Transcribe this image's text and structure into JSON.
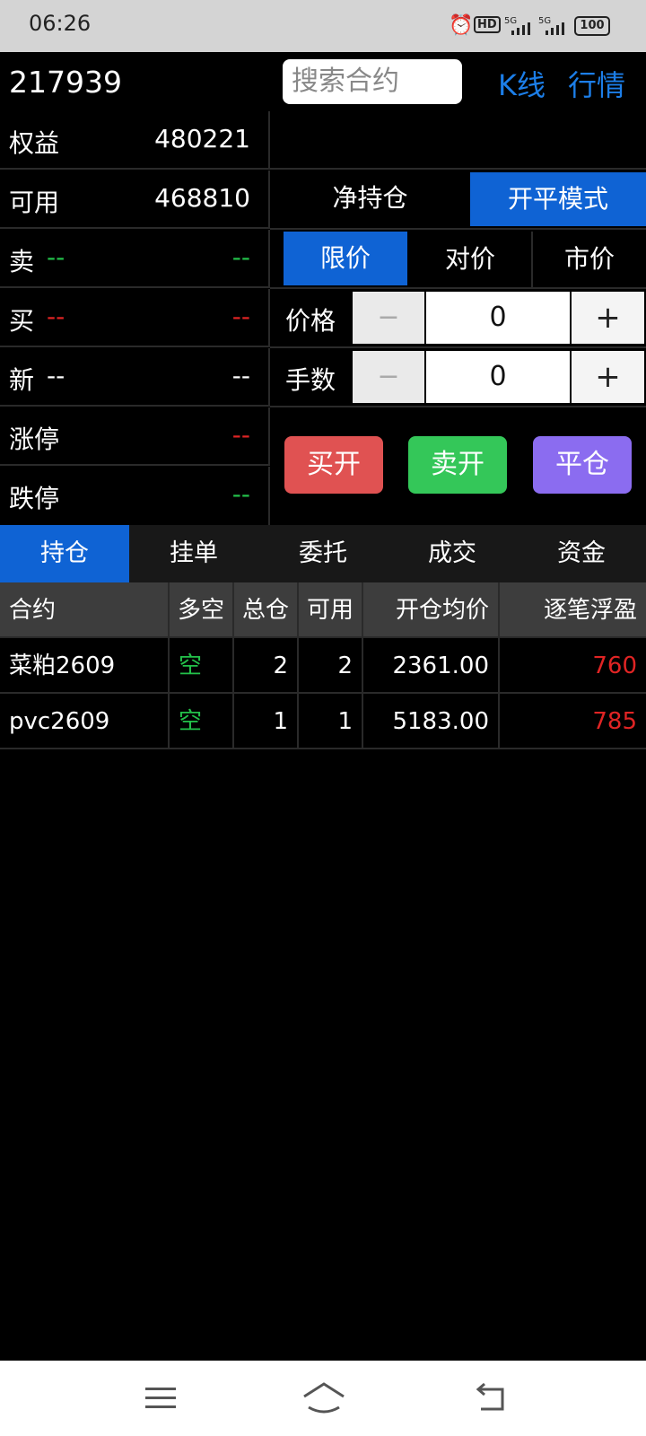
{
  "status": {
    "time": "06:26",
    "battery": "100"
  },
  "header": {
    "account_id": "217939",
    "search_placeholder": "搜索合约",
    "kline_link": "K线",
    "quotes_link": "行情"
  },
  "account": {
    "equity_label": "权益",
    "equity_value": "480221",
    "available_label": "可用",
    "available_value": "468810"
  },
  "quote": {
    "sell_label": "卖",
    "sell_price": "--",
    "sell_volume": "--",
    "buy_label": "买",
    "buy_price": "--",
    "buy_volume": "--",
    "last_label": "新",
    "last_price": "--",
    "last_change": "--",
    "limit_up_label": "涨停",
    "limit_up_value": "--",
    "limit_down_label": "跌停",
    "limit_down_value": "--"
  },
  "mode": {
    "net_position": "净持仓",
    "open_close": "开平模式",
    "active": "open_close"
  },
  "price_types": [
    "限价",
    "对价",
    "市价"
  ],
  "order": {
    "price_label": "价格",
    "price_value": "0",
    "qty_label": "手数",
    "qty_value": "0",
    "minus": "−",
    "plus": "+",
    "buy_open": "买开",
    "sell_open": "卖开",
    "close": "平仓"
  },
  "tabs": [
    "持仓",
    "挂单",
    "委托",
    "成交",
    "资金"
  ],
  "positions": {
    "columns": [
      "合约",
      "多空",
      "总仓",
      "可用",
      "开仓均价",
      "逐笔浮盈"
    ],
    "rows": [
      {
        "contract": "菜粕2609",
        "direction": "空",
        "total": "2",
        "available": "2",
        "avg_price": "2361.00",
        "pnl": "760"
      },
      {
        "contract": "pvc2609",
        "direction": "空",
        "total": "1",
        "available": "1",
        "avg_price": "5183.00",
        "pnl": "785"
      }
    ]
  },
  "colors": {
    "accent": "#0f63d4",
    "link": "#1c7ee8",
    "buy": "#e05252",
    "sell": "#34c759",
    "close": "#8b6cf0",
    "up": "#e02424",
    "down": "#23c14a"
  }
}
